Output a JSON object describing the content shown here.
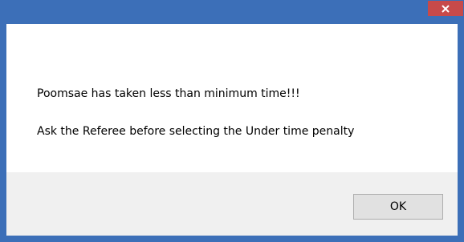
{
  "dialog": {
    "title": "",
    "close_icon": "close-icon",
    "message_line1": "Poomsae has taken less than minimum time!!!",
    "message_line2": "Ask the Referee before selecting the Under time penalty",
    "ok_label": "OK"
  },
  "colors": {
    "titlebar": "#3c6fb8",
    "close_button": "#c74a4a",
    "content_bg": "#ffffff",
    "footer_bg": "#f0f0f0"
  }
}
